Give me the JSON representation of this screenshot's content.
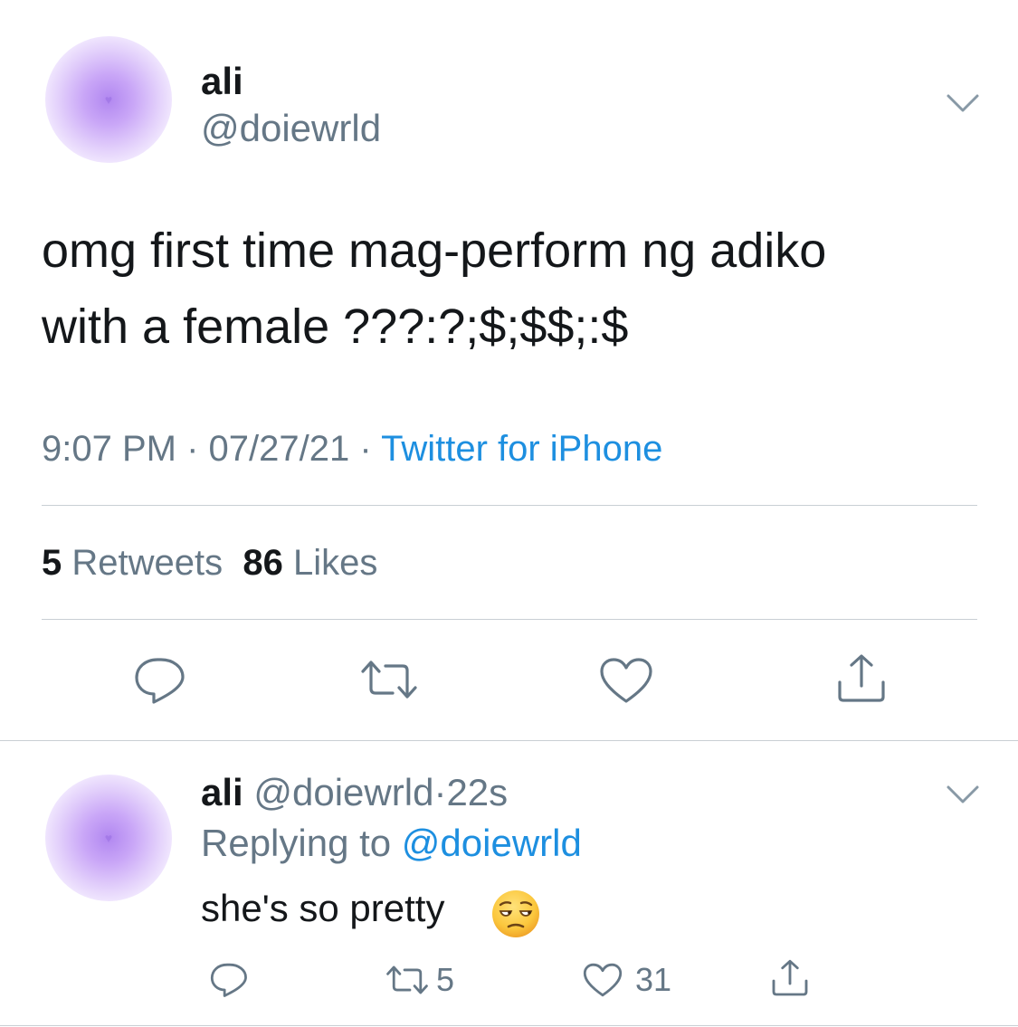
{
  "tweet": {
    "author_name": "ali",
    "author_handle": "@doiewrld",
    "text_line1": "omg first time mag-perform ng adiko",
    "text_line2": "with a female ???:?;$;$$;:$",
    "time": "9:07 PM",
    "date": "07/27/21",
    "separator": "·",
    "source": "Twitter for iPhone",
    "retweets_count": "5",
    "retweets_label": "Retweets",
    "likes_count": "86",
    "likes_label": "Likes",
    "icons": {
      "avatar_badge": "heart-icon",
      "menu": "chevron-down-icon",
      "reply": "reply-icon",
      "retweet": "retweet-icon",
      "like": "like-icon",
      "share": "share-icon"
    }
  },
  "reply": {
    "author_name": "ali",
    "author_handle": "@doiewrld",
    "separator": "·",
    "age": "22s",
    "replying_label": "Replying to",
    "replying_handle": "@doiewrld",
    "text": "she's so pretty",
    "emoji": "unamused-face-emoji",
    "retweet_count": "5",
    "like_count": "31"
  },
  "colors": {
    "text": "#14171a",
    "secondary": "#657786",
    "link": "#1d8fe0",
    "divider": "#c9cfd4",
    "avatar_accent": "#b187f0"
  }
}
